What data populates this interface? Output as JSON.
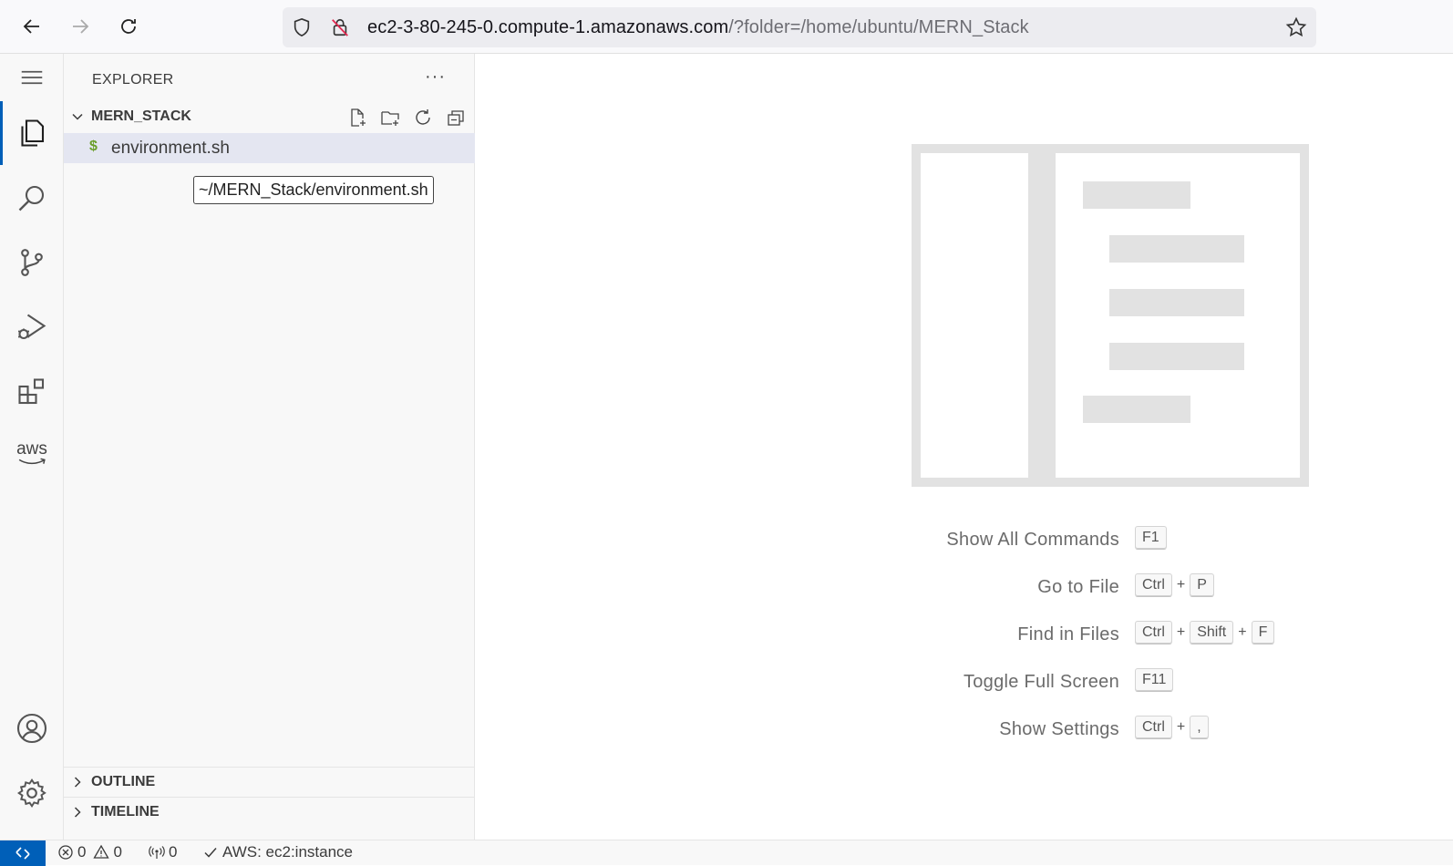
{
  "browser": {
    "url_host": "ec2-3-80-245-0.compute-1.amazonaws.com",
    "url_path": "/?folder=/home/ubuntu/MERN_Stack"
  },
  "activity_bar": {
    "items": [
      "menu-icon",
      "explorer-icon",
      "search-icon",
      "source-control-icon",
      "run-debug-icon",
      "extensions-icon",
      "aws-icon"
    ],
    "bottom": [
      "account-icon",
      "settings-gear-icon"
    ],
    "aws_label": "aws"
  },
  "sidebar": {
    "title": "EXPLORER",
    "more": "···",
    "folder": "MERN_STACK",
    "file": "environment.sh",
    "file_icon": "$",
    "tooltip": "~/MERN_Stack/environment.sh",
    "outline": "OUTLINE",
    "timeline": "TIMELINE"
  },
  "editor": {
    "shortcuts": [
      {
        "label": "Show All Commands",
        "keys": [
          "F1"
        ]
      },
      {
        "label": "Go to File",
        "keys": [
          "Ctrl",
          "P"
        ]
      },
      {
        "label": "Find in Files",
        "keys": [
          "Ctrl",
          "Shift",
          "F"
        ]
      },
      {
        "label": "Toggle Full Screen",
        "keys": [
          "F11"
        ]
      },
      {
        "label": "Show Settings",
        "keys": [
          "Ctrl",
          ","
        ]
      }
    ],
    "plus": "+"
  },
  "status": {
    "errors": "0",
    "warnings": "0",
    "ports": "0",
    "aws": "AWS: ec2:instance"
  },
  "colors": {
    "accent": "#005fb8",
    "file_icon": "#6b9f2b"
  }
}
